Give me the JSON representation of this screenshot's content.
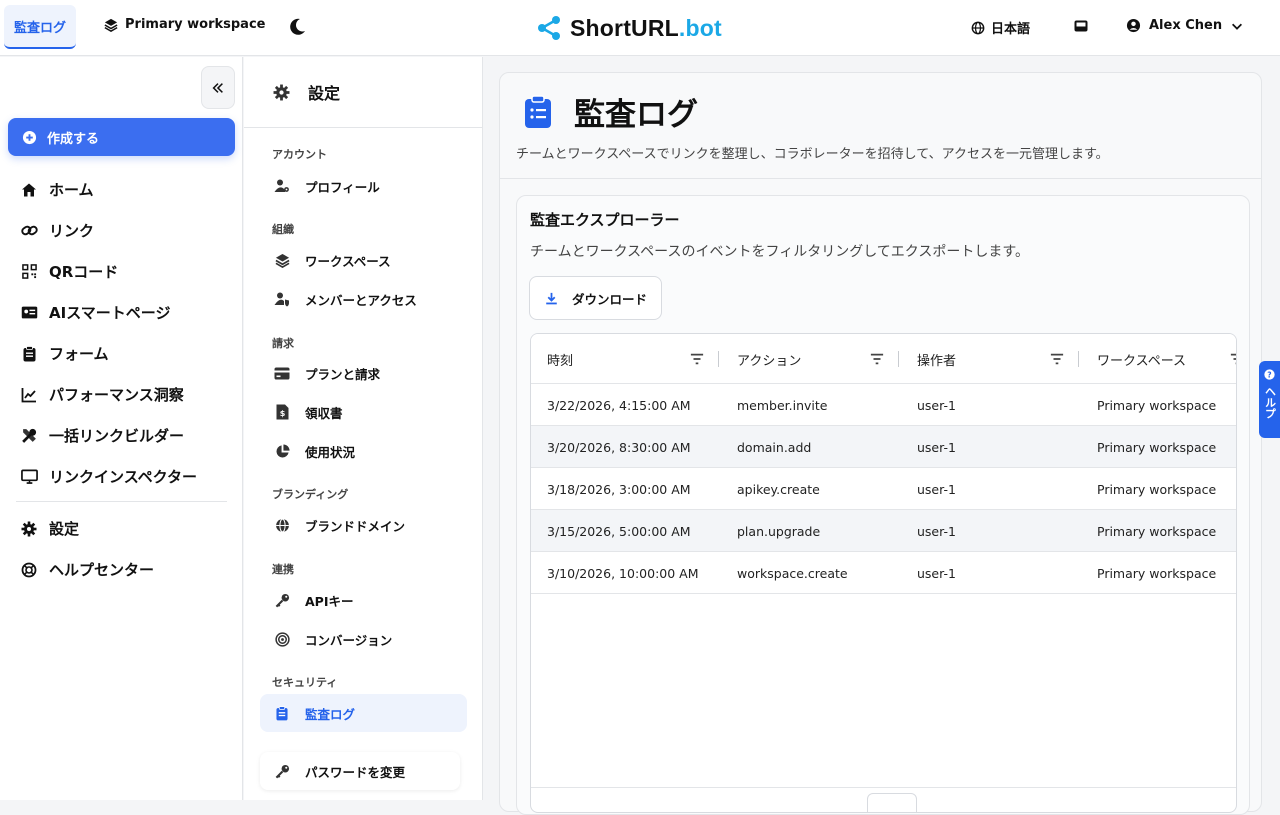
{
  "topbar": {
    "active_tab": "監査ログ",
    "workspace": "Primary workspace",
    "logo_main": "ShortURL",
    "logo_suffix": ".bot",
    "language": "日本語",
    "user_name": "Alex Chen",
    "icons": [
      "layers-icon",
      "moon-icon",
      "globe-icon",
      "inbox-icon",
      "user-circle-icon",
      "chevron-down-icon"
    ]
  },
  "sidebar": {
    "create_label": "作成する",
    "items": [
      {
        "label": "ホーム",
        "icon": "home-icon"
      },
      {
        "label": "リンク",
        "icon": "link-icon"
      },
      {
        "label": "QRコード",
        "icon": "qr-code-icon"
      },
      {
        "label": "AIスマートページ",
        "icon": "id-card-icon"
      },
      {
        "label": "フォーム",
        "icon": "clipboard-icon"
      },
      {
        "label": "パフォーマンス洞察",
        "icon": "line-chart-icon"
      },
      {
        "label": "一括リンクビルダー",
        "icon": "tools-icon"
      },
      {
        "label": "リンクインスペクター",
        "icon": "monitor-icon"
      }
    ],
    "secondary": [
      {
        "label": "設定",
        "icon": "gear-icon"
      },
      {
        "label": "ヘルプセンター",
        "icon": "lifebuoy-icon"
      }
    ]
  },
  "settings": {
    "title": "設定",
    "sections": {
      "account": "アカウント",
      "org": "組織",
      "billing": "請求",
      "branding": "ブランディング",
      "integrations": "連携",
      "security": "セキュリティ"
    },
    "items": {
      "profile": "プロフィール",
      "workspaces": "ワークスペース",
      "members": "メンバーとアクセス",
      "plans": "プランと請求",
      "receipts": "領収書",
      "usage": "使用状況",
      "brand_domain": "ブランドドメイン",
      "api_keys": "APIキー",
      "conversions": "コンバージョン",
      "audit_log": "監査ログ",
      "change_password": "パスワードを変更"
    }
  },
  "main": {
    "title": "監査ログ",
    "subtitle": "チームとワークスペースでリンクを整理し、コラボレーターを招待して、アクセスを一元管理します。",
    "explorer": {
      "title": "監査エクスプローラー",
      "subtitle": "チームとワークスペースのイベントをフィルタリングしてエクスポートします。",
      "download_label": "ダウンロード",
      "columns": [
        "時刻",
        "アクション",
        "操作者",
        "ワークスペース"
      ],
      "rows": [
        [
          "3/22/2026, 4:15:00 AM",
          "member.invite",
          "user-1",
          "Primary workspace"
        ],
        [
          "3/20/2026, 8:30:00 AM",
          "domain.add",
          "user-1",
          "Primary workspace"
        ],
        [
          "3/18/2026, 3:00:00 AM",
          "apikey.create",
          "user-1",
          "Primary workspace"
        ],
        [
          "3/15/2026, 5:00:00 AM",
          "plan.upgrade",
          "user-1",
          "Primary workspace"
        ],
        [
          "3/10/2026, 10:00:00 AM",
          "workspace.create",
          "user-1",
          "Primary workspace"
        ]
      ]
    }
  },
  "help_tab": {
    "label": "ヘルプ"
  }
}
